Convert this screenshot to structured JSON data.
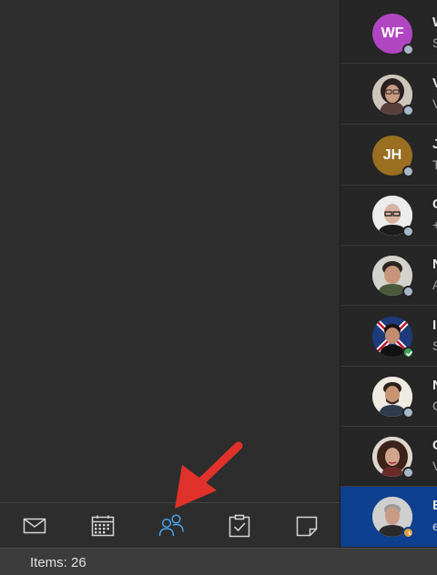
{
  "contacts": [
    {
      "initials": "WF",
      "name": "W",
      "sub": "S",
      "avatar_color": "#b146c2",
      "presence": "offline"
    },
    {
      "initials": "",
      "name": "V",
      "sub": "V",
      "avatar_color": "#d9d2c8",
      "presence": "offline",
      "photo": "woman-glasses"
    },
    {
      "initials": "JH",
      "name": "J",
      "sub": "T",
      "avatar_color": "#9a6f22",
      "presence": "offline"
    },
    {
      "initials": "",
      "name": "C",
      "sub": "+",
      "avatar_color": "#e6e6e6",
      "presence": "offline",
      "photo": "man-bald-glasses"
    },
    {
      "initials": "",
      "name": "N",
      "sub": "A",
      "avatar_color": "#cfcfcf",
      "presence": "offline",
      "photo": "man-dark-hair"
    },
    {
      "initials": "",
      "name": "I",
      "sub": "S",
      "avatar_color": "#3a4f7a",
      "presence": "available",
      "photo": "man-flag"
    },
    {
      "initials": "",
      "name": "N",
      "sub": "C",
      "avatar_color": "#e8e4dd",
      "presence": "offline",
      "photo": "man-beard"
    },
    {
      "initials": "",
      "name": "C",
      "sub": "V",
      "avatar_color": "#e3ddd7",
      "presence": "offline",
      "photo": "woman-curly"
    },
    {
      "initials": "",
      "name": "E",
      "sub": "e",
      "avatar_color": "#d8d8d8",
      "presence": "away",
      "photo": "man-grey",
      "selected": true
    }
  ],
  "nav": {
    "mail_icon": "mail-icon",
    "calendar_icon": "calendar-icon",
    "people_icon": "people-icon",
    "tasks_icon": "tasks-icon",
    "notes_icon": "notes-icon",
    "active": "people",
    "active_color": "#4a9fe8"
  },
  "status": {
    "items_text": "Items: 26"
  },
  "annotation": {
    "arrow_color": "#e0322a"
  }
}
